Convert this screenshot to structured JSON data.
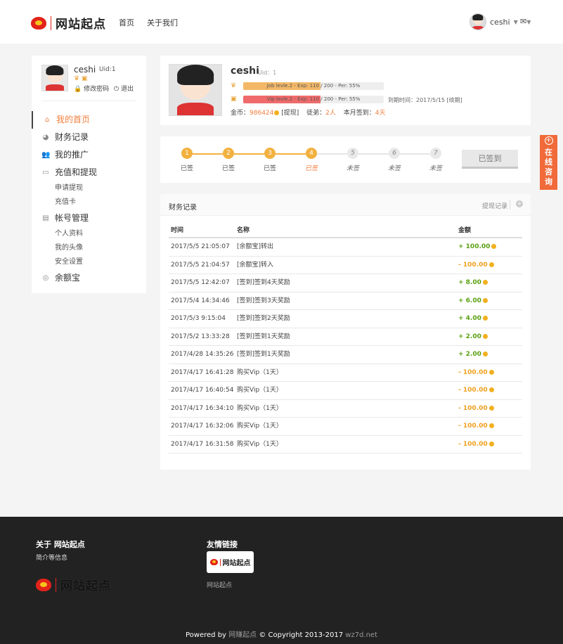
{
  "header": {
    "logo_text": "网站起点",
    "nav": [
      "首页",
      "关于我们"
    ],
    "username": "ceshi"
  },
  "sidebar": {
    "username": "ceshi",
    "uid": "Uid:1",
    "change_password": "修改密码",
    "logout": "退出",
    "menu": [
      {
        "label": "我的首页",
        "icon": "home-icon",
        "active": true
      },
      {
        "label": "财务记录",
        "icon": "pie-chart-icon"
      },
      {
        "label": "我的推广",
        "icon": "users-icon"
      },
      {
        "label": "充值和提现",
        "icon": "credit-card-icon",
        "sub": [
          "申请提现",
          "充值卡"
        ]
      },
      {
        "label": "帐号管理",
        "icon": "id-card-icon",
        "sub": [
          "个人资料",
          "我的头像",
          "安全设置"
        ]
      },
      {
        "label": "余额宝",
        "icon": "coin-icon"
      }
    ]
  },
  "profile": {
    "name": "ceshi",
    "uid": "Uid：1",
    "job_bar": "Job levle.2 - Exp: 110 / 200 - Per: 55%",
    "vip_bar": "Vip levle.2 - Exp: 110 / 200 - Per: 55%",
    "job_percent": 55,
    "vip_percent": 55,
    "expire": "到期时间：2017/5/15 [续期]",
    "coins_label": "金币：",
    "coins": "986424",
    "withdraw": "[提现]",
    "apprentice_label": "徒弟：",
    "apprentice": "2人",
    "month_label": "本月签到：",
    "month_days": "4天"
  },
  "signin": {
    "steps": [
      {
        "n": "1",
        "label": "已签",
        "state": "done"
      },
      {
        "n": "2",
        "label": "已签",
        "state": "done"
      },
      {
        "n": "3",
        "label": "已签",
        "state": "done"
      },
      {
        "n": "4",
        "label": "已签",
        "state": "current"
      },
      {
        "n": "5",
        "label": "未签",
        "state": "off"
      },
      {
        "n": "6",
        "label": "未签",
        "state": "off"
      },
      {
        "n": "7",
        "label": "未签",
        "state": "off"
      }
    ],
    "button": "已签到"
  },
  "records": {
    "title": "财务记录",
    "link": "提现记录",
    "columns": [
      "时间",
      "名称",
      "金额"
    ],
    "rows": [
      [
        "2017/5/5 21:05:07",
        "[余额宝]转出",
        "+ 100.00"
      ],
      [
        "2017/5/5 21:04:57",
        "[余额宝]转入",
        "- 100.00"
      ],
      [
        "2017/5/5 12:42:07",
        "[签到]签到4天奖励",
        "+ 8.00"
      ],
      [
        "2017/5/4 14:34:46",
        "[签到]签到3天奖励",
        "+ 6.00"
      ],
      [
        "2017/5/3 9:15:04",
        "[签到]签到2天奖励",
        "+ 4.00"
      ],
      [
        "2017/5/2 13:33:28",
        "[签到]签到1天奖励",
        "+ 2.00"
      ],
      [
        "2017/4/28 14:35:26",
        "[签到]签到1天奖励",
        "+ 2.00"
      ],
      [
        "2017/4/17 16:41:28",
        "购买Vip（1天）",
        "- 100.00"
      ],
      [
        "2017/4/17 16:40:54",
        "购买Vip（1天）",
        "- 100.00"
      ],
      [
        "2017/4/17 16:34:10",
        "购买Vip（1天）",
        "- 100.00"
      ],
      [
        "2017/4/17 16:32:06",
        "购买Vip（1天）",
        "- 100.00"
      ],
      [
        "2017/4/17 16:31:58",
        "购买Vip（1天）",
        "- 100.00"
      ]
    ]
  },
  "float": {
    "text": "在线咨询"
  },
  "footer": {
    "about": "关于 网站起点",
    "about_sub": "简介等信息",
    "logo_text": "网站起点",
    "links_title": "友情链接",
    "card_text": "网站起点",
    "card_caption": "网站起点",
    "copy_powered": "Powered by",
    "copy_site": "网赚起点",
    "copy_text": "© Copyright 2013-2017",
    "copy_domain": "wz7d.net"
  },
  "colors": {
    "accent": "#f08040",
    "gold": "#f2b13f",
    "positive": "#5aa012",
    "negative": "#f0a020",
    "job_bar": "#f2b868",
    "vip_bar": "#ef6a6a"
  }
}
